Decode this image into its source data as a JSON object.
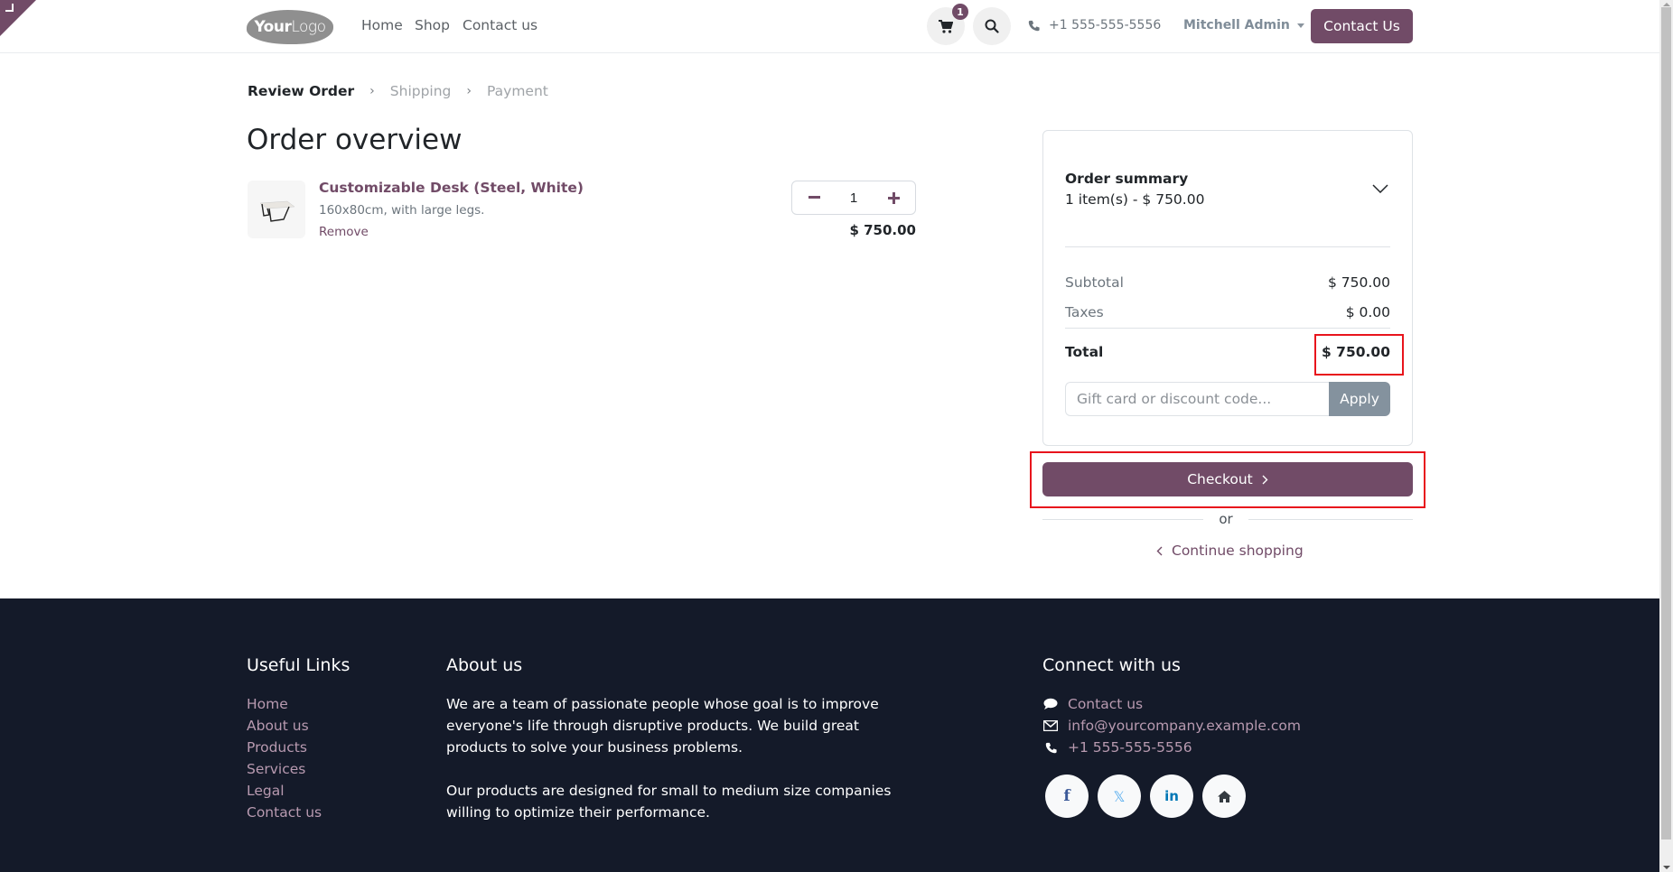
{
  "header": {
    "logo": {
      "bold": "Your",
      "light": "Logo"
    },
    "nav": [
      "Home",
      "Shop",
      "Contact us"
    ],
    "cart_count": "1",
    "phone": "+1 555-555-5556",
    "user": "Mitchell Admin",
    "contact_button": "Contact Us",
    "brand_color": "#714B67"
  },
  "breadcrumb": {
    "steps": [
      "Review Order",
      "Shipping",
      "Payment"
    ],
    "active_index": 0
  },
  "page_title": "Order overview",
  "order_line": {
    "name": "Customizable Desk (Steel, White)",
    "description": "160x80cm, with large legs.",
    "remove_label": "Remove",
    "quantity": "1",
    "price": "$ 750.00"
  },
  "summary": {
    "title": "Order summary",
    "items_text": "1 item(s) -  $ 750.00",
    "subtotal_label": "Subtotal",
    "subtotal": "$ 750.00",
    "taxes_label": "Taxes",
    "taxes": "$ 0.00",
    "total_label": "Total",
    "total": "$ 750.00",
    "coupon_placeholder": "Gift card or discount code...",
    "apply_label": "Apply",
    "checkout_label": "Checkout",
    "or_label": "or",
    "continue_label": "Continue shopping"
  },
  "footer": {
    "useful_links_title": "Useful Links",
    "useful_links": [
      "Home",
      "About us",
      "Products",
      "Services",
      "Legal",
      "Contact us"
    ],
    "about_title": "About us",
    "about_p1": "We are a team of passionate people whose goal is to improve everyone's life through disruptive products. We build great products to solve your business problems.",
    "about_p2": "Our products are designed for small to medium size companies willing to optimize their performance.",
    "connect_title": "Connect with us",
    "contact_link": "Contact us",
    "email": "info@yourcompany.example.com",
    "phone": "+1 555-555-5556",
    "socials": [
      "facebook",
      "x",
      "linkedin",
      "home"
    ]
  }
}
